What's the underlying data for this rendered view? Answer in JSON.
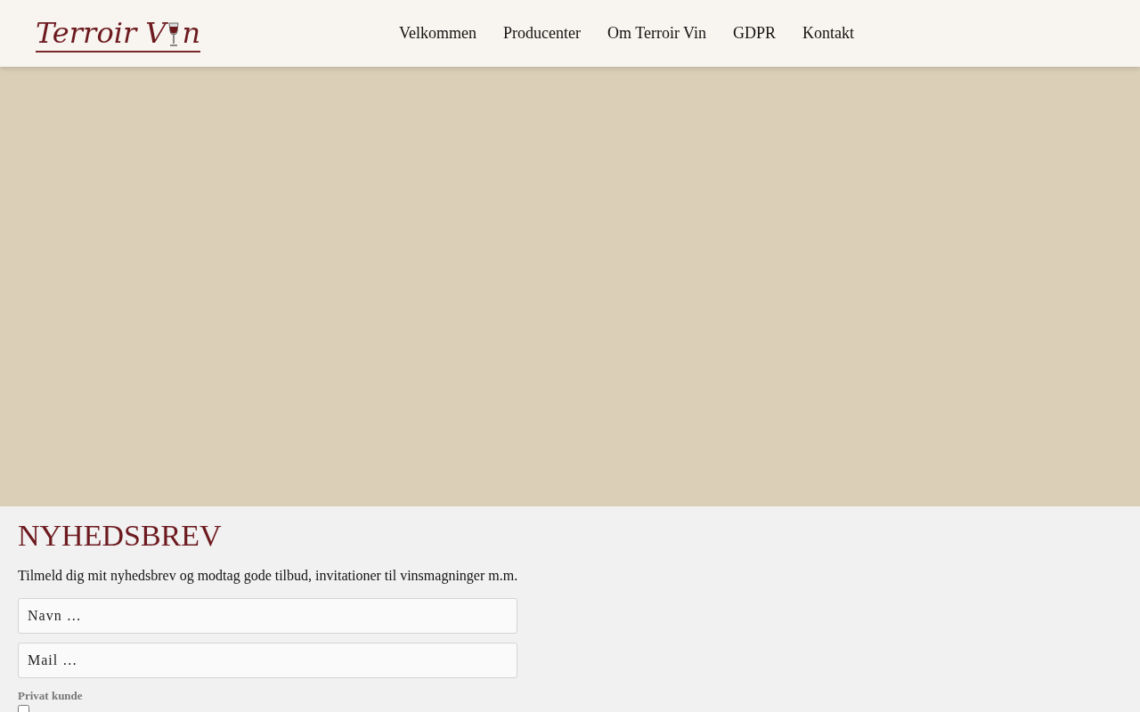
{
  "header": {
    "logo": {
      "before": "Terroir V",
      "after": "n"
    },
    "nav": [
      {
        "label": "Velkommen"
      },
      {
        "label": "Producenter"
      },
      {
        "label": "Om Terroir Vin"
      },
      {
        "label": "GDPR"
      },
      {
        "label": "Kontakt"
      }
    ]
  },
  "newsletter": {
    "title": "NYHEDSBREV",
    "description": "Tilmeld dig mit nyhedsbrev og modtag gode tilbud, invitationer til vinsmagninger m.m.",
    "fields": [
      {
        "placeholder": "Navn …"
      },
      {
        "placeholder": "Mail …"
      }
    ],
    "checkbox": {
      "label": "Privat kunde",
      "checked": false
    }
  }
}
